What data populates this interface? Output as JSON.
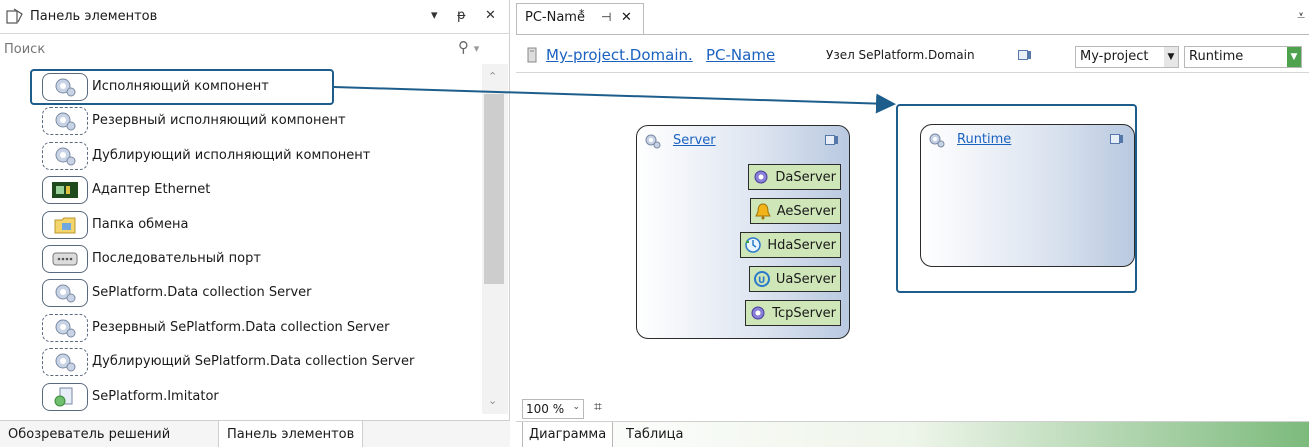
{
  "toolbox": {
    "title": "Панель элементов",
    "pin": "▾",
    "dock": "ᵽ",
    "close": "✕",
    "search_placeholder": "Поиск",
    "items": [
      {
        "label": "Исполняющий компонент",
        "icon": "component-icon",
        "style": "solid"
      },
      {
        "label": "Резервный исполняющий компонент",
        "icon": "component-icon",
        "style": "dashed"
      },
      {
        "label": "Дублирующий исполняющий компонент",
        "icon": "component-icon",
        "style": "dashed"
      },
      {
        "label": "Адаптер Ethernet",
        "icon": "ethernet-adapter-icon",
        "style": "solid"
      },
      {
        "label": "Папка обмена",
        "icon": "exchange-folder-icon",
        "style": "solid"
      },
      {
        "label": "Последовательный порт",
        "icon": "serial-port-icon",
        "style": "solid"
      },
      {
        "label": "SePlatform.Data collection Server",
        "icon": "component-icon",
        "style": "solid"
      },
      {
        "label": "Резервный SePlatform.Data collection Server",
        "icon": "component-icon",
        "style": "dashed"
      },
      {
        "label": "Дублирующий SePlatform.Data collection Server",
        "icon": "component-icon",
        "style": "dashed"
      },
      {
        "label": "SePlatform.Imitator",
        "icon": "imitator-icon",
        "style": "solid"
      }
    ],
    "tabs": [
      {
        "label": "Обозреватель решений"
      },
      {
        "label": "Панель элементов"
      }
    ]
  },
  "document": {
    "tab_label": "PC-Name",
    "tab_modified": "*",
    "tab_pin": "⊣",
    "tab_close": "✕",
    "breadcrumb": {
      "part1": "My-project.Domain.",
      "part2": "PC-Name",
      "node_label": "Узел SePlatform.Domain"
    },
    "project_combo": "My-project",
    "runtime_combo": "Runtime",
    "zoom": "100 %",
    "bottom_tabs": [
      {
        "label": "Диаграмма"
      },
      {
        "label": "Таблица"
      }
    ]
  },
  "diagram": {
    "server_node": {
      "title": "Server",
      "children": [
        {
          "label": "DaServer",
          "icon": "gear-icon"
        },
        {
          "label": "AeServer",
          "icon": "bell-icon"
        },
        {
          "label": "HdaServer",
          "icon": "history-icon"
        },
        {
          "label": "UaServer",
          "icon": "ua-icon"
        },
        {
          "label": "TcpServer",
          "icon": "gear-icon"
        }
      ]
    },
    "runtime_node": {
      "title": "Runtime"
    }
  },
  "colors": {
    "accent": "#1d5d8c",
    "link": "#1b62c0",
    "service_fill": "#cfe6b8"
  }
}
